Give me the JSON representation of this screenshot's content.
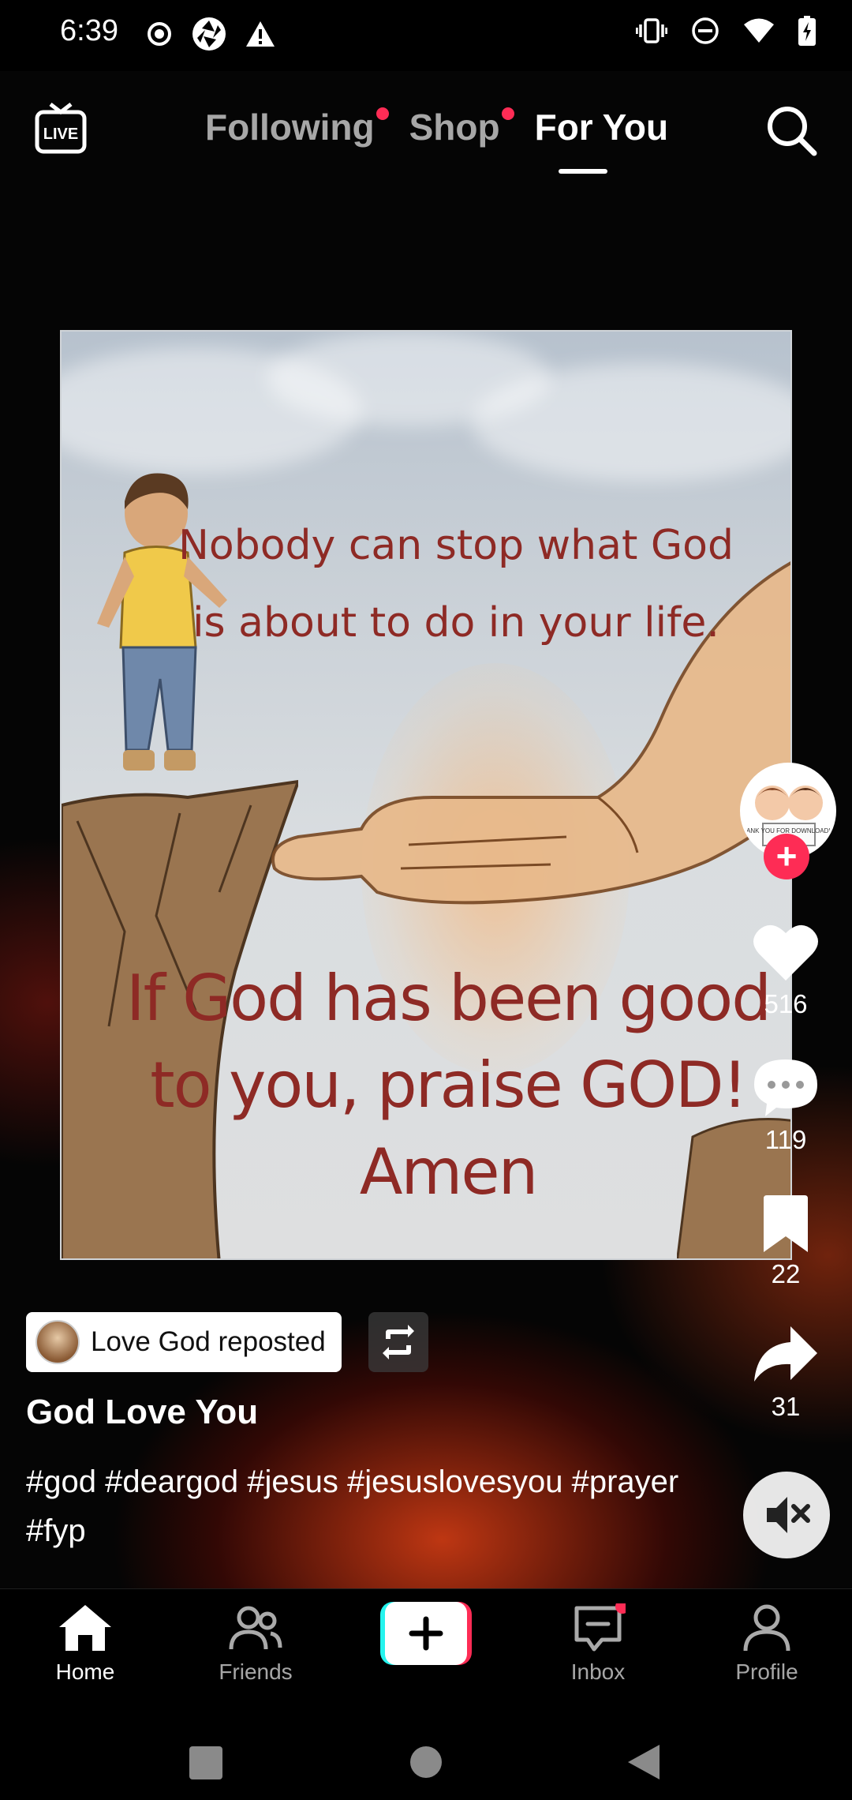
{
  "status_bar": {
    "time": "6:39",
    "left_icons": [
      "radio-icon",
      "camera-aperture-icon",
      "warning-icon"
    ],
    "right_icons": [
      "vibrate-icon",
      "do-not-disturb-icon",
      "wifi-icon",
      "battery-charging-icon"
    ]
  },
  "top_nav": {
    "live_label": "LIVE",
    "tabs": [
      {
        "label": "Following",
        "has_dot": true
      },
      {
        "label": "Shop",
        "has_dot": true
      },
      {
        "label": "For You",
        "active": true
      }
    ]
  },
  "video": {
    "poster_text_top": "Nobody can stop what God is about to do in your life.",
    "poster_text_bottom": "If God has been good to you, praise GOD! Amen",
    "avatar_caption": "THANK YOU FOR DOWNLOADING"
  },
  "actions": {
    "likes": "516",
    "comments": "119",
    "saves": "22",
    "shares": "31"
  },
  "caption": {
    "repost_label": "Love God reposted",
    "author": "God Love You",
    "description": "#god #deargod #jesus #jesuslovesyou #prayer #fyp"
  },
  "bottom_nav": {
    "items": [
      {
        "label": "Home",
        "active": true
      },
      {
        "label": "Friends"
      },
      {
        "label": "Inbox",
        "has_dot": true
      },
      {
        "label": "Profile"
      }
    ]
  },
  "colors": {
    "accent_red": "#fe2c55",
    "accent_cyan": "#25f4ee",
    "quote_text": "#8e2a25"
  }
}
